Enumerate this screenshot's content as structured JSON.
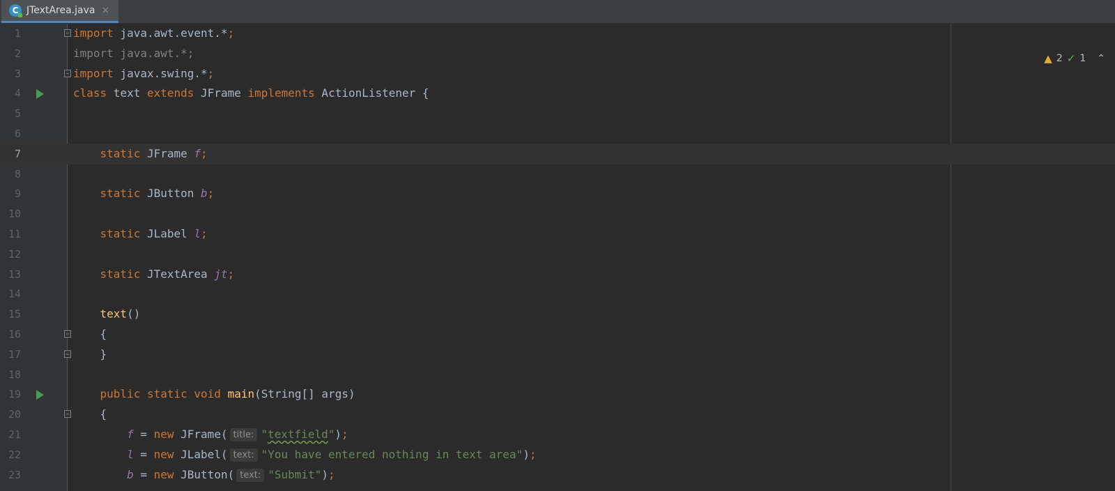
{
  "tab": {
    "label": "JTextArea.java",
    "icon": "java-class-icon",
    "close": "×"
  },
  "inspections": {
    "warnings": "2",
    "checks": "1"
  },
  "colors": {
    "background": "#2b2b2b",
    "keyword": "#cc7832",
    "string": "#6a8759",
    "field": "#9876aa",
    "function": "#ffc66d",
    "text": "#a9b7c6"
  },
  "lines": [
    {
      "n": "1",
      "html": "<span class=\"kw\">import</span> java.awt.event.*<span class=\"kw\">;</span>",
      "fold": true
    },
    {
      "n": "2",
      "html": "<span class=\"faded\">import java.awt.*;</span>"
    },
    {
      "n": "3",
      "html": "<span class=\"kw\">import</span> javax.swing.*<span class=\"kw\">;</span>",
      "fold": true
    },
    {
      "n": "4",
      "html": "<span class=\"kw\">class</span> text <span class=\"kw\">extends</span> JFrame <span class=\"kw\">implements</span> ActionListener {",
      "run": true
    },
    {
      "n": "5",
      "html": ""
    },
    {
      "n": "6",
      "html": ""
    },
    {
      "n": "7",
      "html": "    <span class=\"kw\">static</span> JFrame <span class=\"field\">f</span><span class=\"kw\">;</span>",
      "current": true
    },
    {
      "n": "8",
      "html": ""
    },
    {
      "n": "9",
      "html": "    <span class=\"kw\">static</span> JButton <span class=\"field\">b</span><span class=\"kw\">;</span>"
    },
    {
      "n": "10",
      "html": ""
    },
    {
      "n": "11",
      "html": "    <span class=\"kw\">static</span> JLabel <span class=\"field\">l</span><span class=\"kw\">;</span>"
    },
    {
      "n": "12",
      "html": ""
    },
    {
      "n": "13",
      "html": "    <span class=\"kw\">static</span> JTextArea <span class=\"field\">jt</span><span class=\"kw\">;</span>"
    },
    {
      "n": "14",
      "html": ""
    },
    {
      "n": "15",
      "html": "    <span class=\"fn\">text</span>()"
    },
    {
      "n": "16",
      "html": "    {",
      "fold": true
    },
    {
      "n": "17",
      "html": "    }",
      "fold": true
    },
    {
      "n": "18",
      "html": ""
    },
    {
      "n": "19",
      "html": "    <span class=\"kw\">public static void</span> <span class=\"fn\">main</span>(String[] args)",
      "run": true
    },
    {
      "n": "20",
      "html": "    {",
      "fold": true
    },
    {
      "n": "21",
      "html": "        <span class=\"field\">f</span> = <span class=\"kw\">new</span> JFrame(<span class=\"hint\">title:</span><span class=\"str\">\"<span class=\"squiggle\">textfield</span>\"</span>)<span class=\"kw\">;</span>"
    },
    {
      "n": "22",
      "html": "        <span class=\"field\">l</span> = <span class=\"kw\">new</span> JLabel(<span class=\"hint\">text:</span><span class=\"str\">\"You have entered nothing in text area\"</span>)<span class=\"kw\">;</span>"
    },
    {
      "n": "23",
      "html": "        <span class=\"field\">b</span> = <span class=\"kw\">new</span> JButton(<span class=\"hint\">text:</span><span class=\"str\">\"Submit\"</span>)<span class=\"kw\">;</span>"
    }
  ]
}
